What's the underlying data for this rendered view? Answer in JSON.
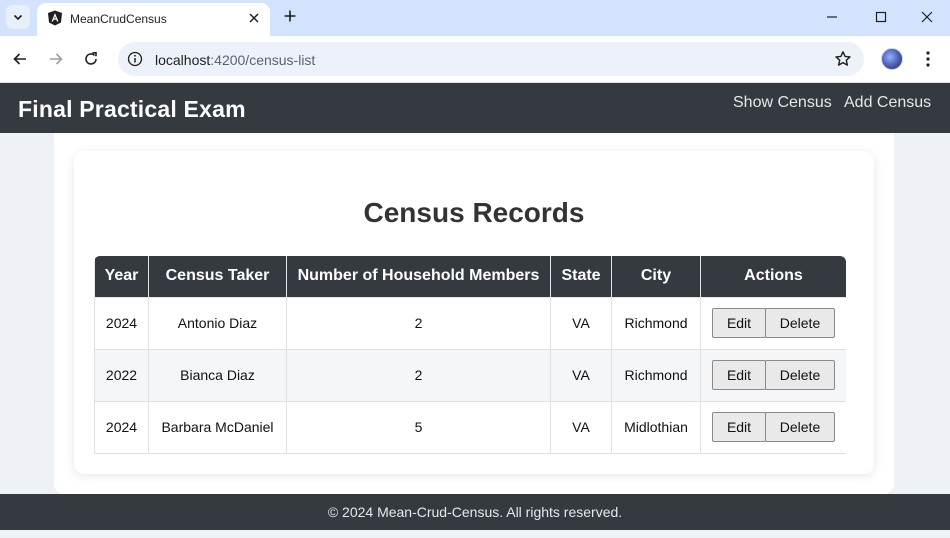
{
  "browser": {
    "tab_title": "MeanCrudCensus",
    "url_host": "localhost",
    "url_path": ":4200/census-list"
  },
  "app": {
    "brand": "Final Practical Exam",
    "nav": {
      "show_census": "Show Census",
      "add_census": "Add Census"
    },
    "page_title": "Census Records",
    "table": {
      "headers": [
        "Year",
        "Census Taker",
        "Number of Household Members",
        "State",
        "City",
        "Actions"
      ],
      "rows": [
        {
          "year": "2024",
          "census_taker": "Antonio Diaz",
          "household_members": "2",
          "state": "VA",
          "city": "Richmond"
        },
        {
          "year": "2022",
          "census_taker": "Bianca Diaz",
          "household_members": "2",
          "state": "VA",
          "city": "Richmond"
        },
        {
          "year": "2024",
          "census_taker": "Barbara McDaniel",
          "household_members": "5",
          "state": "VA",
          "city": "Midlothian"
        }
      ],
      "edit_label": "Edit",
      "delete_label": "Delete"
    },
    "footer": "© 2024 Mean-Crud-Census. All rights reserved."
  },
  "colors": {
    "navbar": "#343a40",
    "tabstrip": "#d3e3fd",
    "page_background": "#eef1f5"
  }
}
